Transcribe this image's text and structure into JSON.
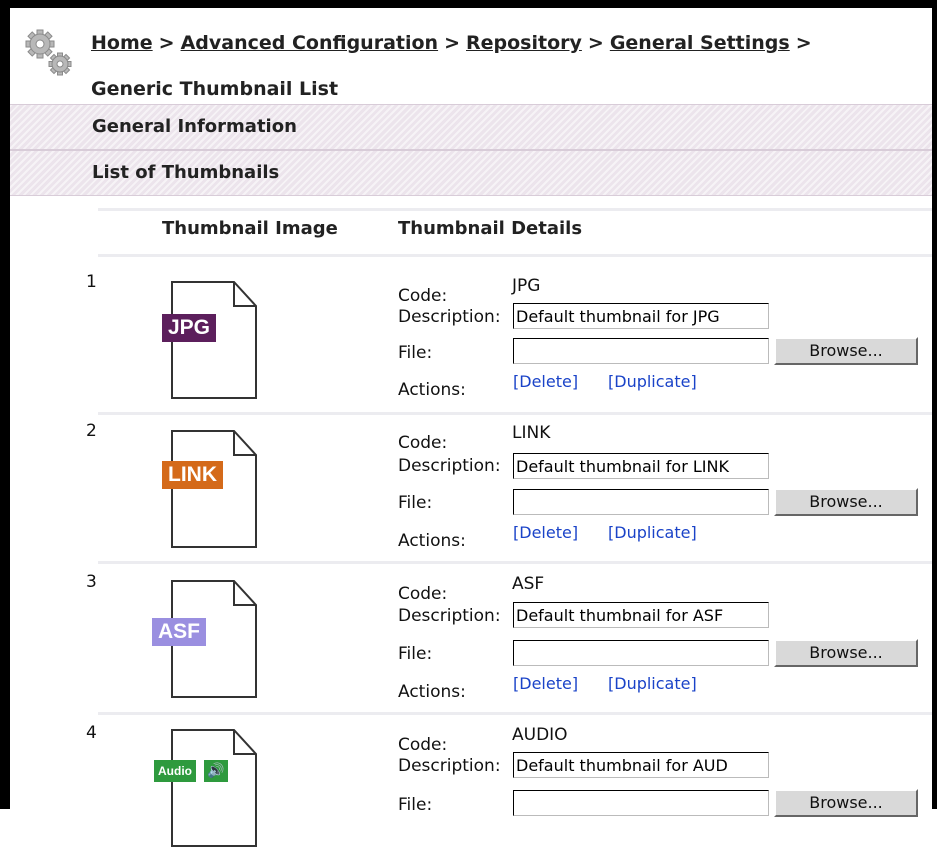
{
  "breadcrumb": {
    "items": [
      "Home",
      "Advanced Configuration",
      "Repository",
      "General Settings"
    ],
    "separator": ">",
    "current": "Generic Thumbnail List"
  },
  "sections": {
    "general_information": "General Information",
    "list_of_thumbnails": "List of Thumbnails"
  },
  "table": {
    "headers": {
      "image": "Thumbnail Image",
      "details": "Thumbnail Details"
    },
    "labels": {
      "code": "Code:",
      "description": "Description:",
      "file": "File:",
      "actions": "Actions:"
    },
    "browse_label": "Browse...",
    "delete_label": "[Delete]",
    "duplicate_label": "[Duplicate]",
    "rows": [
      {
        "number": "1",
        "badge": "JPG",
        "code": "JPG",
        "description": "Default thumbnail for JPG",
        "badge_color": "#5c1f5c"
      },
      {
        "number": "2",
        "badge": "LINK",
        "code": "LINK",
        "description": "Default thumbnail for LINK",
        "badge_color": "#d46a1a"
      },
      {
        "number": "3",
        "badge": "ASF",
        "code": "ASF",
        "description": "Default thumbnail for ASF",
        "badge_color": "#9a8fe0"
      },
      {
        "number": "4",
        "badge": "Audio",
        "code": "AUDIO",
        "description": "Default thumbnail for AUD",
        "badge_color": "#2e9a3e"
      }
    ]
  },
  "colors": {
    "band": "#ece4ec",
    "link": "#1a43c8"
  }
}
